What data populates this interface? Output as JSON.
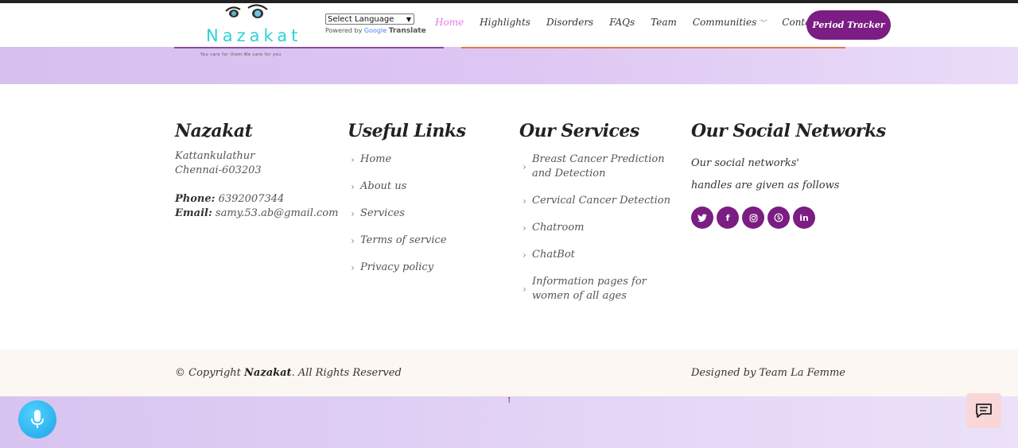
{
  "header": {
    "logo": {
      "name": "Nazakat",
      "tagline": "You care for them.We care for you"
    },
    "translate": {
      "select_label": "Select Language",
      "powered_by": "Powered by",
      "google": "Google",
      "translate": "Translate"
    },
    "nav": [
      "Home",
      "Highlights",
      "Disorders",
      "FAQs",
      "Team",
      "Communities",
      "Contact Us"
    ],
    "tracker_button": "Period Tracker"
  },
  "footer": {
    "brand": {
      "title": "Nazakat",
      "address_line1": "Kattankulathur",
      "address_line2": "Chennai-603203",
      "phone_label": "Phone:",
      "phone": "6392007344",
      "email_label": "Email:",
      "email": "samy.53.ab@gmail.com"
    },
    "useful_links": {
      "title": "Useful Links",
      "items": [
        "Home",
        "About us",
        "Services",
        "Terms of service",
        "Privacy policy"
      ]
    },
    "services": {
      "title": "Our Services",
      "items": [
        "Breast Cancer Prediction and Detection",
        "Cervical Cancer Detection",
        "Chatroom",
        "ChatBot",
        "Information pages for women of all ages"
      ]
    },
    "social": {
      "title": "Our Social Networks",
      "text": "Our social networks' handles are given as follows",
      "icons": [
        "twitter-icon",
        "facebook-icon",
        "instagram-icon",
        "skype-icon",
        "linkedin-icon"
      ]
    }
  },
  "copyright": {
    "prefix": "© Copyright",
    "brand": "Nazakat",
    "suffix": ". All Rights Reserved",
    "designed_by": "Designed by Team La Femme"
  },
  "colors": {
    "brand_purple": "#7b1d82",
    "active_link": "#e779e6",
    "logo_teal": "#2cd3d8"
  }
}
